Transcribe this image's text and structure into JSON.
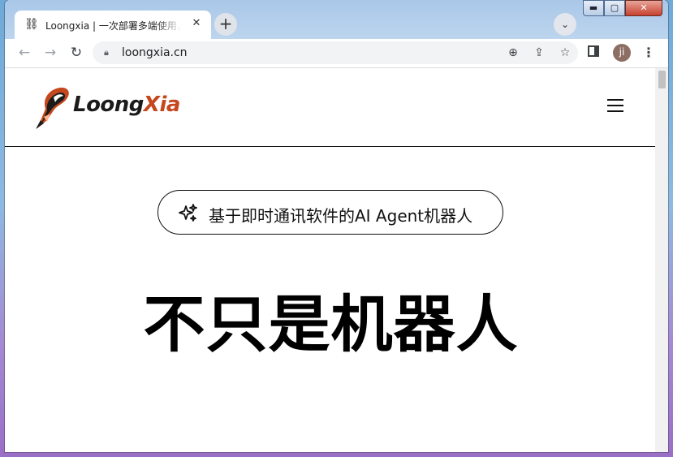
{
  "browser": {
    "tab": {
      "title": "Loongxia | 一次部署多端使用，…",
      "favicon": "loongxia-favicon",
      "close_label": "✕"
    },
    "new_tab_label": "+",
    "tab_search_label": "⌄",
    "window_controls": {
      "minimize": "▬",
      "maximize": "▢",
      "close": "✕"
    },
    "nav": {
      "back": "←",
      "forward": "→",
      "reload": "↻"
    },
    "address": {
      "url": "loongxia.cn",
      "lock_icon": "lock-icon"
    },
    "toolbar_icons": [
      "zoom-icon",
      "share-icon",
      "bookmark-star-icon",
      "side-panel-icon",
      "profile-avatar",
      "menu-icon"
    ],
    "profile_initials": "ji",
    "menu_label": "⋮"
  },
  "page": {
    "logo": {
      "text_dark": "Loong",
      "text_accent": "Xia",
      "accent_color": "#c4471e"
    },
    "nav_menu_icon": "hamburger-menu-icon",
    "badge": {
      "icon": "sparkles-icon",
      "text": "基于即时通讯软件的AI Agent机器人"
    },
    "headline": "不只是机器人"
  }
}
